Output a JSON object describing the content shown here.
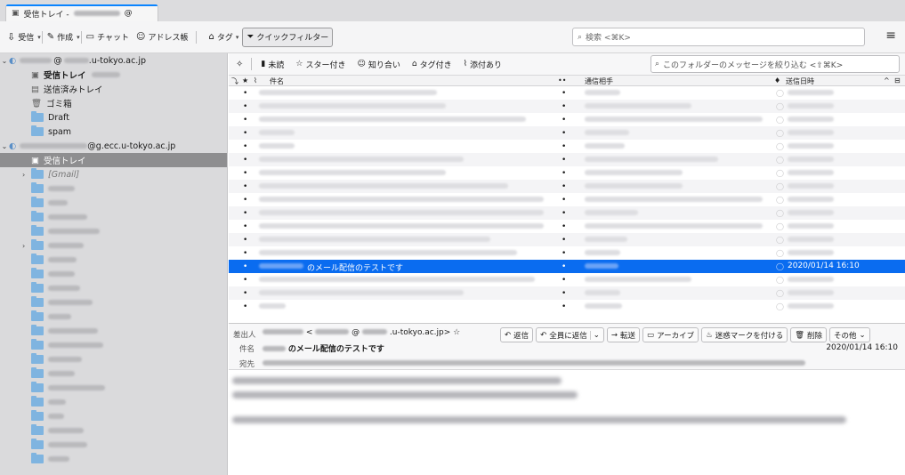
{
  "tab": {
    "title": "受信トレイ - ",
    "suffix": "@"
  },
  "toolbar": {
    "get_mail": "受信",
    "write": "作成",
    "chat": "チャット",
    "address_book": "アドレス帳",
    "tag": "タグ",
    "quick_filter": "クイックフィルター",
    "search_placeholder": "検索 <⌘K>"
  },
  "folders": {
    "account1_suffix": ".u-tokyo.ac.jp",
    "account1_at": "@",
    "inbox": "受信トレイ",
    "sent": "送信済みトレイ",
    "trash": "ゴミ箱",
    "drafts": "Draft",
    "spam": "spam",
    "account2_suffix": "@g.ecc.u-tokyo.ac.jp",
    "inbox2": "受信トレイ",
    "gmail": "[Gmail]"
  },
  "quickfilter": {
    "unread": "未読",
    "starred": "スター付き",
    "contacts": "知り合い",
    "tagged": "タグ付き",
    "attachment": "添付あり",
    "search_placeholder": "このフォルダーのメッセージを絞り込む <⇧⌘K>"
  },
  "columns": {
    "subject": "件名",
    "correspondent": "通信相手",
    "date": "送信日時"
  },
  "selected_message": {
    "subject": "のメール配信のテストです",
    "date": "2020/01/14 16:10"
  },
  "header": {
    "from_label": "差出人",
    "from_lt": "<",
    "from_at": "@",
    "from_domain": ".u-tokyo.ac.jp>",
    "subject_label": "件名",
    "subject": "のメール配信のテストです",
    "to_label": "宛先",
    "date": "2020/01/14 16:10"
  },
  "actions": {
    "reply": "返信",
    "reply_all": "全員に返信",
    "forward": "転送",
    "archive": "アーカイブ",
    "junk": "迷惑マークを付ける",
    "delete": "削除",
    "other": "その他"
  }
}
